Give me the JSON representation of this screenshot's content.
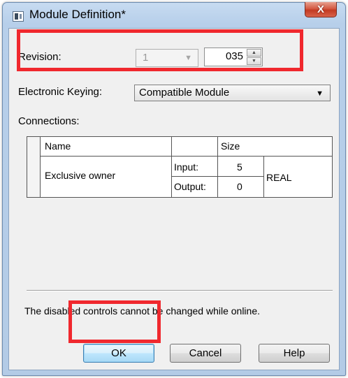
{
  "window": {
    "title": "Module Definition*",
    "close_glyph": "X"
  },
  "form": {
    "revision_label": "Revision:",
    "revision_major": "1",
    "revision_minor": "035",
    "keying_label": "Electronic Keying:",
    "keying_value": "Compatible Module",
    "connections_label": "Connections:"
  },
  "connections_table": {
    "headers": {
      "name": "Name",
      "size": "Size"
    },
    "row": {
      "name": "Exclusive owner",
      "input_label": "Input:",
      "input_size": "5",
      "output_label": "Output:",
      "output_size": "0",
      "type": "REAL"
    }
  },
  "footer": {
    "message": "The disabled controls cannot be changed while online.",
    "ok_label": "OK",
    "cancel_label": "Cancel",
    "help_label": "Help"
  },
  "highlight_color": "#f0282e",
  "icons": [
    "app-icon",
    "close-icon",
    "chevron-down-icon",
    "spin-up-icon",
    "spin-down-icon"
  ]
}
